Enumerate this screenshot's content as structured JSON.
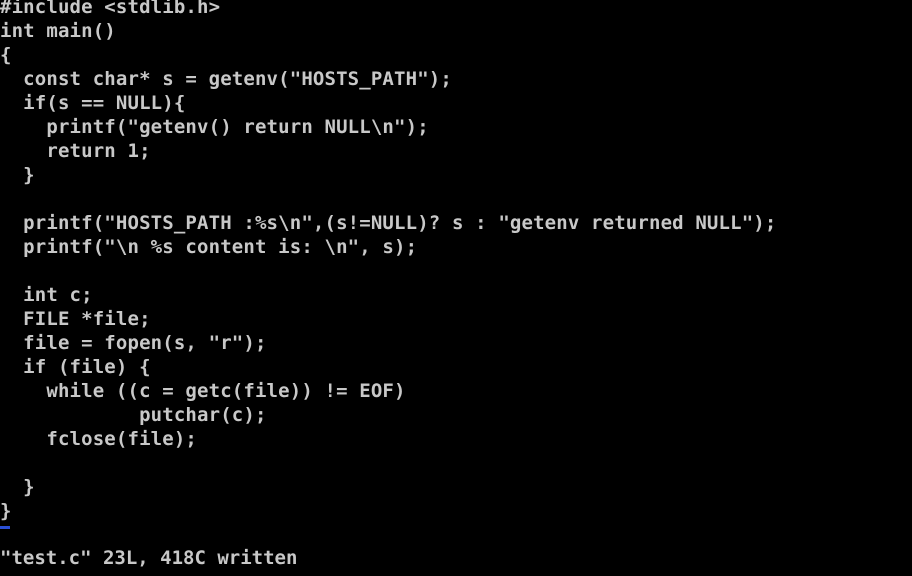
{
  "editor": {
    "lines": [
      "#include <stdlib.h>",
      "int main()",
      "{",
      "  const char* s = getenv(\"HOSTS_PATH\");",
      "  if(s == NULL){",
      "    printf(\"getenv() return NULL\\n\");",
      "    return 1;",
      "  }",
      "",
      "  printf(\"HOSTS_PATH :%s\\n\",(s!=NULL)? s : \"getenv returned NULL\");",
      "  printf(\"\\n %s content is: \\n\", s);",
      "",
      "  int c;",
      "  FILE *file;",
      "  file = fopen(s, \"r\");",
      "  if (file) {",
      "    while ((c = getc(file)) != EOF)",
      "            putchar(c);",
      "    fclose(file);",
      "",
      "  }",
      "}"
    ],
    "status_message": "\"test.c\" 23L, 418C written"
  },
  "colors": {
    "background": "#000000",
    "text": "#c8c8c8",
    "cursor": "#2a4fd6"
  }
}
